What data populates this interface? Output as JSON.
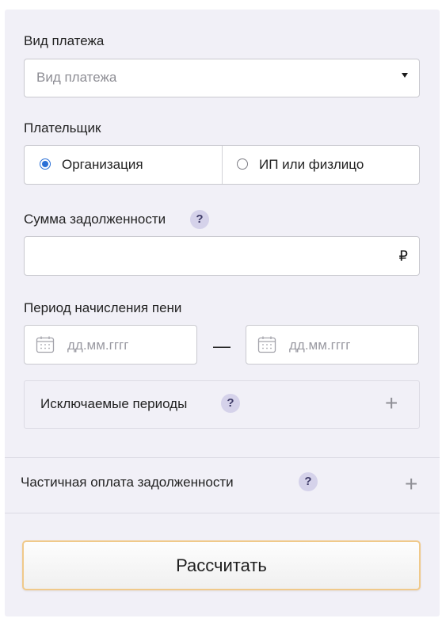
{
  "payment_type": {
    "label": "Вид платежа",
    "placeholder": "Вид платежа"
  },
  "payer": {
    "label": "Плательщик",
    "options": [
      {
        "label": "Организация",
        "selected": true
      },
      {
        "label": "ИП или физлицо",
        "selected": false
      }
    ]
  },
  "debt_amount": {
    "label": "Сумма задолженности",
    "help": "?",
    "value": "",
    "currency": "₽"
  },
  "penalty_period": {
    "label": "Период начисления пени",
    "from_placeholder": "дд.мм.гггг",
    "to_placeholder": "дд.мм.гггг",
    "separator": "—"
  },
  "excluded_periods": {
    "label": "Исключаемые периоды",
    "help": "?",
    "add": "+"
  },
  "partial_payment": {
    "label": "Частичная оплата задолженности",
    "help": "?",
    "add": "+"
  },
  "submit": {
    "label": "Рассчитать"
  },
  "colors": {
    "panel": "#f1f0f7",
    "radio_accent": "#2a6fd6",
    "help_badge": "#d5d2ea",
    "button_border": "#f0c98a"
  }
}
